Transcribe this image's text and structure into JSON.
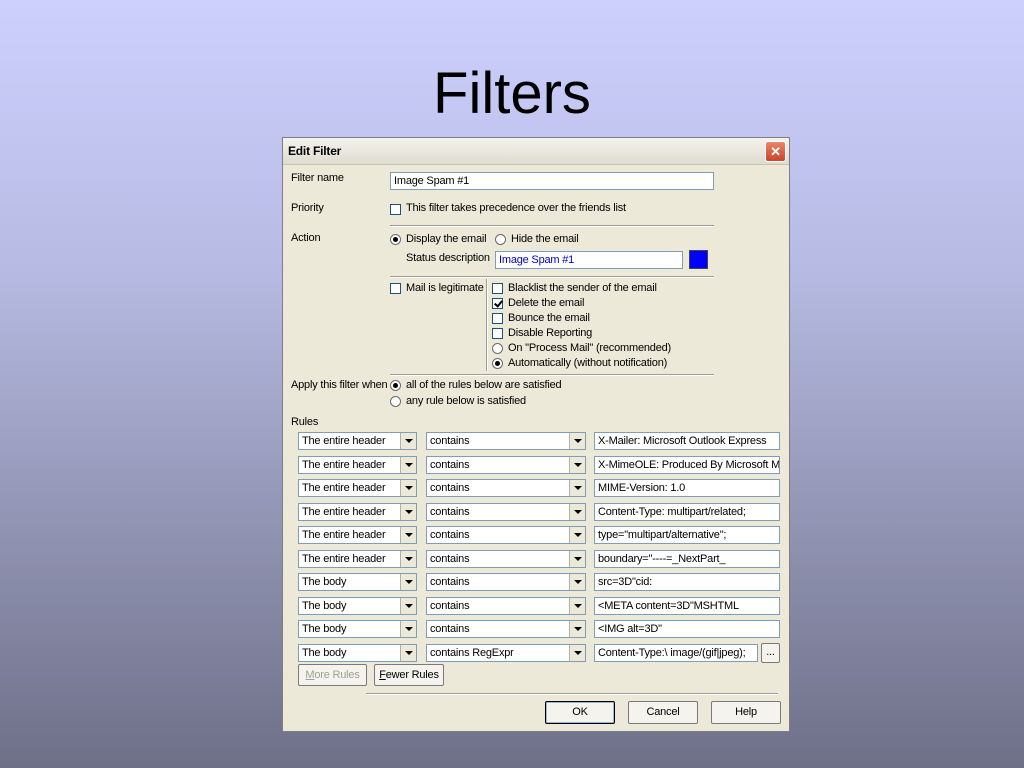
{
  "slide": {
    "title": "Filters"
  },
  "dialog": {
    "title": "Edit Filter",
    "close_icon": "close-icon",
    "filter_name": {
      "label": "Filter name",
      "value": "Image Spam #1"
    },
    "priority": {
      "label": "Priority",
      "checkbox_label": "This filter takes precedence over the friends list",
      "checked": false
    },
    "action": {
      "label": "Action",
      "display_label": "Display the email",
      "hide_label": "Hide the email",
      "selected": "display",
      "status_label": "Status description",
      "status_value": "Image Spam #1",
      "color": "#0000ff"
    },
    "legit": {
      "label": "Mail is legitimate",
      "checked": false
    },
    "options": {
      "blacklist": "Blacklist the sender of the email",
      "delete": "Delete the email",
      "bounce": "Bounce the email",
      "disable": "Disable Reporting",
      "on_process": "On \"Process Mail\" (recommended)",
      "automatic": "Automatically (without notification)"
    },
    "apply": {
      "label": "Apply this filter when",
      "all": "all of the rules below are satisfied",
      "any": "any rule below is satisfied"
    },
    "rules_label": "Rules",
    "rules": [
      {
        "field": "The entire header",
        "op": "contains",
        "value": "X-Mailer: Microsoft Outlook Express"
      },
      {
        "field": "The entire header",
        "op": "contains",
        "value": "X-MimeOLE: Produced By Microsoft MimeOLE"
      },
      {
        "field": "The entire header",
        "op": "contains",
        "value": "MIME-Version: 1.0"
      },
      {
        "field": "The entire header",
        "op": "contains",
        "value": "Content-Type: multipart/related;"
      },
      {
        "field": "The entire header",
        "op": "contains",
        "value": "type=\"multipart/alternative\";"
      },
      {
        "field": "The entire header",
        "op": "contains",
        "value": "boundary=\"----=_NextPart_"
      },
      {
        "field": "The body",
        "op": "contains",
        "value": "src=3D\"cid:"
      },
      {
        "field": "The body",
        "op": "contains",
        "value": "<META content=3D\"MSHTML"
      },
      {
        "field": "The body",
        "op": "contains",
        "value": "<IMG alt=3D\""
      },
      {
        "field": "The body",
        "op": "contains RegExpr",
        "value": "Content-Type:\\ image/(gif|jpeg);"
      }
    ],
    "more_btn": "...",
    "more_rules": {
      "first": "M",
      "rest": "ore Rules"
    },
    "fewer_rules": {
      "first": "F",
      "rest": "ewer Rules"
    },
    "ok": "OK",
    "cancel": "Cancel",
    "help": "Help"
  }
}
